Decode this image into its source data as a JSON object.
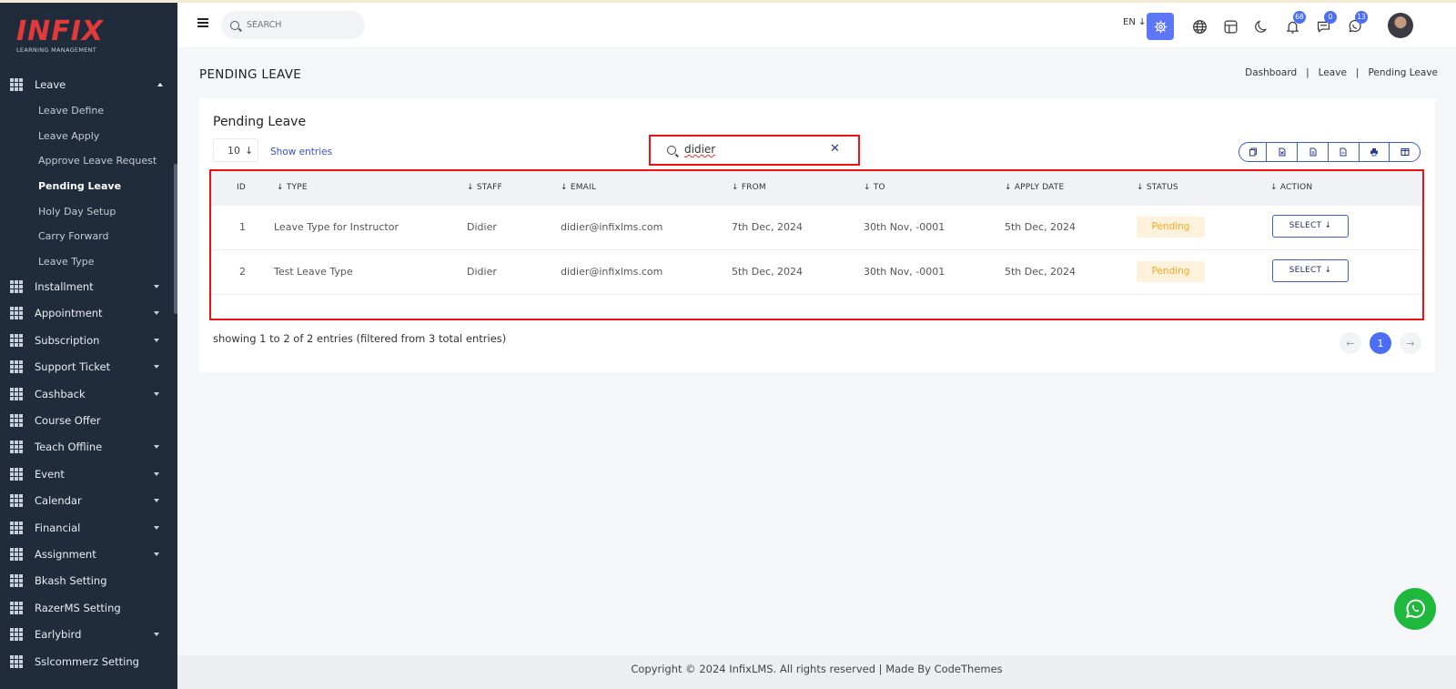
{
  "brand": {
    "name": "INFIX",
    "tagline": "LEARNING MANAGEMENT"
  },
  "sidebar": {
    "open_menu": "Leave",
    "sub_items": [
      "Leave Define",
      "Leave Apply",
      "Approve Leave Request",
      "Pending Leave",
      "Holy Day Setup",
      "Carry Forward",
      "Leave Type"
    ],
    "active_sub": "Pending Leave",
    "items": [
      {
        "label": "Installment",
        "caret": true
      },
      {
        "label": "Appointment",
        "caret": true
      },
      {
        "label": "Subscription",
        "caret": true
      },
      {
        "label": "Support Ticket",
        "caret": true
      },
      {
        "label": "Cashback",
        "caret": true
      },
      {
        "label": "Course Offer",
        "caret": false
      },
      {
        "label": "Teach Offline",
        "caret": true
      },
      {
        "label": "Event",
        "caret": true
      },
      {
        "label": "Calendar",
        "caret": true
      },
      {
        "label": "Financial",
        "caret": true
      },
      {
        "label": "Assignment",
        "caret": true
      },
      {
        "label": "Bkash Setting",
        "caret": false
      },
      {
        "label": "RazerMS Setting",
        "caret": false
      },
      {
        "label": "Earlybird",
        "caret": true
      },
      {
        "label": "Sslcommerz Setting",
        "caret": false
      }
    ]
  },
  "header": {
    "search_placeholder": "SEARCH",
    "lang": "EN",
    "notifications": "68",
    "messages": "0",
    "chats": "13",
    "accent_color": "#5d76f5"
  },
  "page": {
    "title": "PENDING LEAVE",
    "breadcrumb": [
      "Dashboard",
      "Leave",
      "Pending Leave"
    ]
  },
  "card": {
    "title": "Pending Leave",
    "page_size": "10",
    "show_entries": "Show entries",
    "filter_value": "didier",
    "columns": [
      "ID",
      "TYPE",
      "STAFF",
      "EMAIL",
      "FROM",
      "TO",
      "APPLY DATE",
      "STATUS",
      "ACTION"
    ],
    "rows": [
      {
        "id": "1",
        "type": "Leave Type for Instructor",
        "staff": "Didier",
        "email": "didier@infixlms.com",
        "from": "7th Dec, 2024",
        "to": "30th Nov, -0001",
        "apply": "5th Dec, 2024",
        "status": "Pending",
        "action": "SELECT"
      },
      {
        "id": "2",
        "type": "Test Leave Type",
        "staff": "Didier",
        "email": "didier@infixlms.com",
        "from": "5th Dec, 2024",
        "to": "30th Nov, -0001",
        "apply": "5th Dec, 2024",
        "status": "Pending",
        "action": "SELECT"
      }
    ],
    "showing": "showing 1 to 2 of 2 entries (filtered from 3 total entries)",
    "current_page": "1"
  },
  "footer": {
    "text": "Copyright © 2024 InfixLMS. All rights reserved | Made By CodeThemes"
  }
}
